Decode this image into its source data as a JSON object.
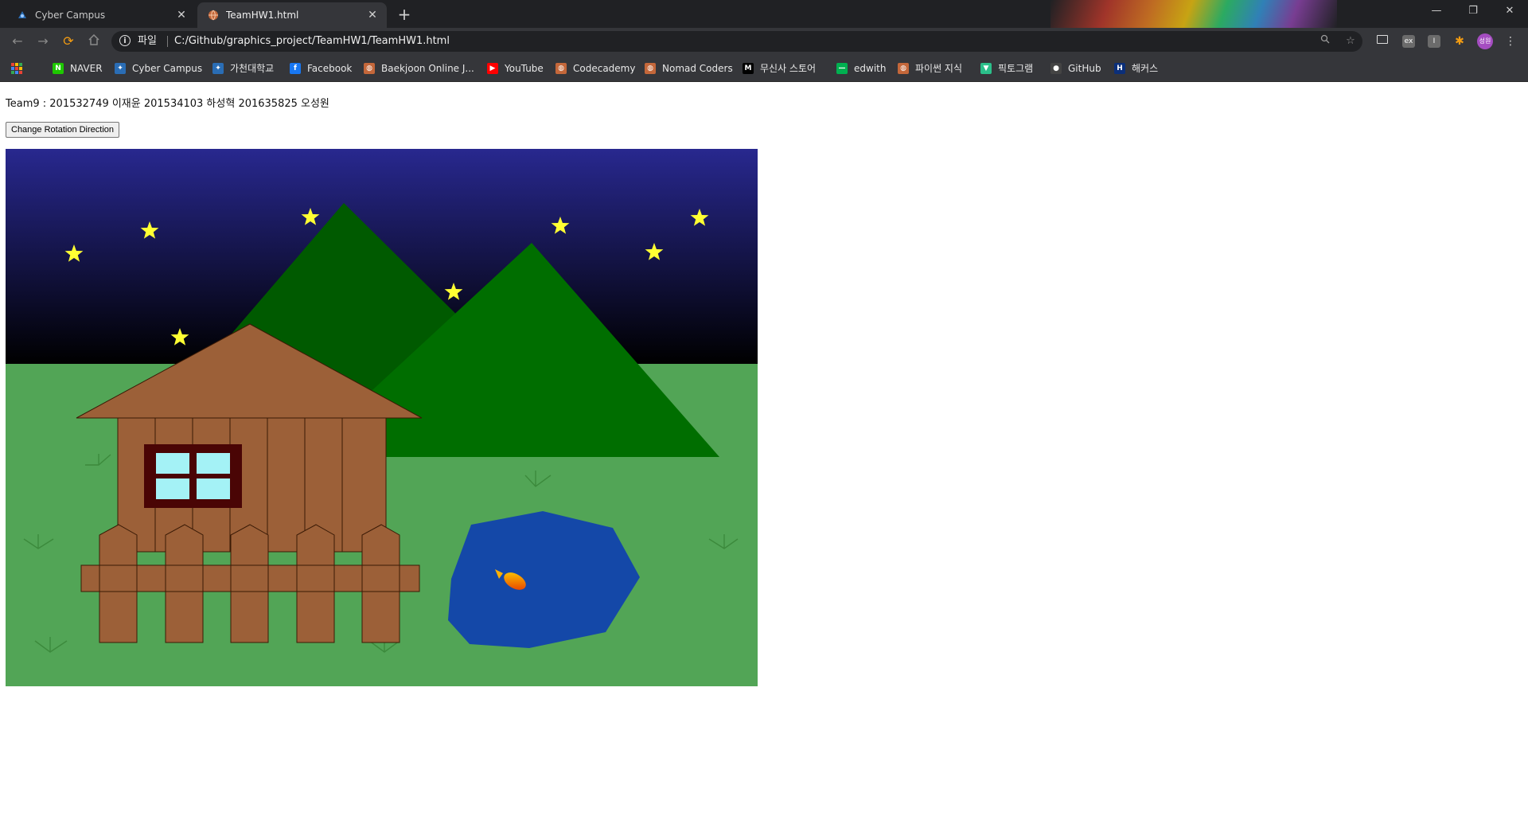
{
  "browser": {
    "tabs": [
      {
        "title": "Cyber Campus",
        "active": false,
        "icon": "cyber-campus-icon"
      },
      {
        "title": "TeamHW1.html",
        "active": true,
        "icon": "globe-icon"
      }
    ],
    "address": {
      "scheme_label": "파일",
      "url": "C:/Github/graphics_project/TeamHW1/TeamHW1.html"
    },
    "profile_initials": "성원",
    "bookmarks": [
      {
        "label": "NAVER",
        "icon": "naver-icon",
        "color": "#1ec800",
        "glyph": "N"
      },
      {
        "label": "Cyber Campus",
        "icon": "cyber-campus-icon",
        "color": "#2a6db5",
        "glyph": "✦"
      },
      {
        "label": "가천대학교",
        "icon": "gachon-icon",
        "color": "#2a6db5",
        "glyph": "✦"
      },
      {
        "label": "Facebook",
        "icon": "facebook-icon",
        "color": "#1877f2",
        "glyph": "f"
      },
      {
        "label": "Baekjoon Online J...",
        "icon": "globe-icon",
        "color": "#c4673a",
        "glyph": "◍"
      },
      {
        "label": "YouTube",
        "icon": "youtube-icon",
        "color": "#ff0000",
        "glyph": "▶"
      },
      {
        "label": "Codecademy",
        "icon": "globe-icon",
        "color": "#c4673a",
        "glyph": "◍"
      },
      {
        "label": "Nomad Coders",
        "icon": "globe-icon",
        "color": "#c4673a",
        "glyph": "◍"
      },
      {
        "label": "무신사 스토어",
        "icon": "musinsa-icon",
        "color": "#000000",
        "glyph": "M"
      },
      {
        "label": "edwith",
        "icon": "edwith-icon",
        "color": "#00b050",
        "glyph": "—"
      },
      {
        "label": "파이썬 지식",
        "icon": "globe-icon",
        "color": "#c4673a",
        "glyph": "◍"
      },
      {
        "label": "픽토그램",
        "icon": "pictogram-icon",
        "color": "#2bbf8a",
        "glyph": "▼"
      },
      {
        "label": "GitHub",
        "icon": "github-icon",
        "color": "#444444",
        "glyph": "●"
      },
      {
        "label": "해커스",
        "icon": "hackers-icon",
        "color": "#0b2f7a",
        "glyph": "H"
      }
    ]
  },
  "page": {
    "team_text": "Team9 : 201532749 이재윤 201534103 하성혁 201635825 오성원",
    "button_label": "Change Rotation Direction"
  },
  "scene": {
    "colors": {
      "sky_top": "#28288f",
      "sky_bottom": "#000000",
      "grass": "#52a556",
      "mountain_back": "#005a00",
      "mountain_front": "#006e00",
      "house_wood": "#9c6038",
      "window_frame": "#4a0505",
      "window_glass": "#a4f2f6",
      "pond": "#1448a8",
      "star": "#ffff33"
    }
  }
}
